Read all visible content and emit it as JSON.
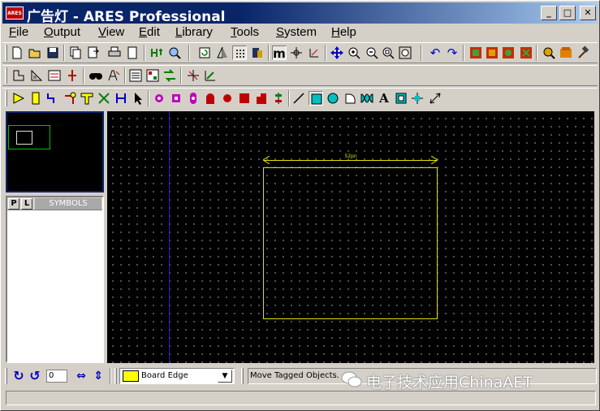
{
  "window": {
    "title": "广告灯 - ARES Professional",
    "logo_text": "ARES",
    "minimize": "_",
    "maximize": "□",
    "close": "✕"
  },
  "menu": [
    "File",
    "Output",
    "View",
    "Edit",
    "Library",
    "Tools",
    "System",
    "Help"
  ],
  "selector": {
    "p_label": "P",
    "l_label": "L",
    "title": "SYMBOLS"
  },
  "canvas": {
    "dimension_label": "52pn",
    "colors": {
      "background": "#000000",
      "board_edge": "#e0e000",
      "origin": "#2020d0"
    }
  },
  "bottom": {
    "rotation_value": "0",
    "layer_name": "Board Edge",
    "layer_color": "#ffff00",
    "status_message": "Move Tagged Objects."
  },
  "watermark": "电子技术应用ChinaAET"
}
